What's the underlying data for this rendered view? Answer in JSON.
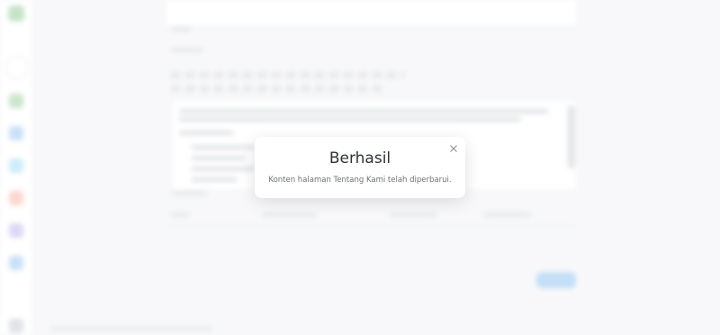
{
  "modal": {
    "title": "Berhasil",
    "message": "Konten halaman Tentang Kami telah diperbarui.",
    "close_icon": "close-icon"
  },
  "colors": {
    "accent": "#4a9be5",
    "brand": "#4caf50",
    "modal_bg": "#ffffff",
    "overlay": "#f4f5f7"
  },
  "sidebar": {
    "icons": [
      "logo-icon",
      "avatar",
      "dashboard-icon",
      "document-icon",
      "user-icon",
      "alert-icon",
      "page-icon",
      "settings-icon",
      "help-icon"
    ]
  }
}
